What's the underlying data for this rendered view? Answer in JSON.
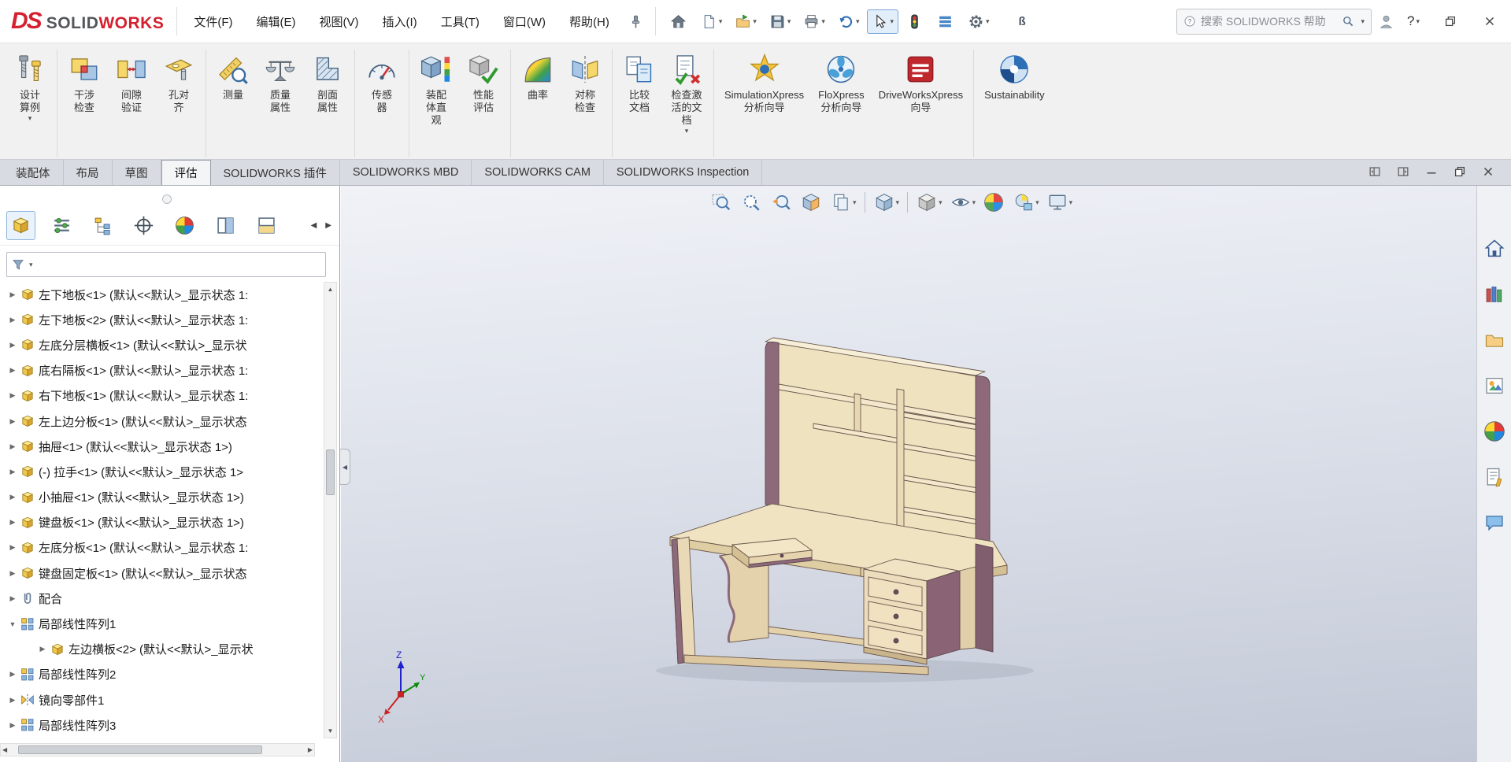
{
  "colors": {
    "brand_red": "#d5202f",
    "accent_blue": "#2f6fb6",
    "wood": "#ead9b4",
    "trim": "#8d6979",
    "viewport_top": "#f0f2f7",
    "viewport_bottom": "#c2c8d6"
  },
  "titlebar": {
    "logo": {
      "ds": "DS",
      "solid": "SOLID",
      "works": "WORKS"
    },
    "menus": [
      "文件(F)",
      "编辑(E)",
      "视图(V)",
      "插入(I)",
      "工具(T)",
      "窗口(W)",
      "帮助(H)"
    ],
    "quick_tools": [
      {
        "icon": "#q-home",
        "name": "home-button",
        "dd": ""
      },
      {
        "icon": "#q-new",
        "name": "new-document-button",
        "dd": "▾"
      },
      {
        "icon": "#q-open",
        "name": "open-document-button",
        "dd": "▾"
      },
      {
        "icon": "#q-save",
        "name": "save-button",
        "dd": "▾"
      },
      {
        "icon": "#q-print",
        "name": "print-button",
        "dd": "▾"
      },
      {
        "icon": "#q-undo",
        "name": "undo-button",
        "dd": "▾"
      },
      {
        "icon": "#q-cursor",
        "name": "select-tool-button",
        "dd": "▾",
        "cls": "active"
      },
      {
        "icon": "#q-traffic",
        "name": "rebuild-status-light",
        "dd": ""
      },
      {
        "icon": "#q-list",
        "name": "command-list-button",
        "dd": ""
      },
      {
        "icon": "#q-gear",
        "name": "options-button",
        "dd": "▾"
      },
      {
        "glyph": "ß",
        "name": "misc-tool",
        "dd": ""
      }
    ],
    "search": {
      "placeholder": "搜索 SOLIDWORKS 帮助",
      "dd": "▾"
    },
    "help": {
      "label": "?",
      "dd": "▾"
    },
    "window": [
      {
        "icon": "#w-restore",
        "name": "restore-app-button"
      },
      {
        "icon": "#w-close",
        "name": "close-app-button"
      }
    ]
  },
  "ribbon": {
    "buttons": [
      {
        "icon": "#r-study",
        "label": "设计\n算例",
        "dd": "▾",
        "name": "design-study-button",
        "cls": "grp-end"
      },
      {
        "icon": "#r-interf",
        "label": "干涉\n检查",
        "dd": "",
        "name": "interference-check-button"
      },
      {
        "icon": "#r-clear",
        "label": "间隙\n验证",
        "dd": "",
        "name": "clearance-verify-button"
      },
      {
        "icon": "#r-hole",
        "label": "孔对\n齐",
        "dd": "",
        "name": "hole-alignment-button",
        "cls": "grp-end"
      },
      {
        "icon": "#r-measure",
        "label": "测量",
        "dd": "",
        "name": "measure-button"
      },
      {
        "icon": "#r-mass",
        "label": "质量\n属性",
        "dd": "",
        "name": "mass-properties-button"
      },
      {
        "icon": "#r-secprop",
        "label": "剖面\n属性",
        "dd": "",
        "name": "section-properties-button",
        "cls": "grp-end"
      },
      {
        "icon": "#r-sensor",
        "label": "传感\n器",
        "dd": "",
        "name": "sensor-button",
        "cls": "grp-end"
      },
      {
        "icon": "#r-visual",
        "label": "装配\n体直\n观",
        "dd": "",
        "name": "assembly-visualization-button"
      },
      {
        "icon": "#r-perf",
        "label": "性能\n评估",
        "dd": "",
        "name": "performance-evaluation-button",
        "cls": "grp-end"
      },
      {
        "icon": "#r-curv",
        "label": "曲率",
        "dd": "",
        "name": "curvature-button"
      },
      {
        "icon": "#r-symm",
        "label": "对称\n检查",
        "dd": "",
        "name": "symmetry-check-button",
        "cls": "grp-end"
      },
      {
        "icon": "#r-compare",
        "label": "比较\n文档",
        "dd": "",
        "name": "compare-documents-button"
      },
      {
        "icon": "#r-checkdoc",
        "label": "检查激\n活的文\n档",
        "dd": "▾",
        "name": "check-active-document-button",
        "cls": "grp-end"
      },
      {
        "icon": "#r-simx",
        "label": "SimulationXpress\n分析向导",
        "dd": "",
        "name": "simulationxpress-button"
      },
      {
        "icon": "#r-flox",
        "label": "FloXpress\n分析向导",
        "dd": "",
        "name": "floxpress-button"
      },
      {
        "icon": "#r-dwx",
        "label": "DriveWorksXpress\n向导",
        "dd": "",
        "name": "driveworksxpress-button",
        "cls": "grp-end"
      },
      {
        "icon": "#r-sust",
        "label": "Sustainability",
        "dd": "",
        "name": "sustainability-button"
      }
    ]
  },
  "tabs": {
    "items": [
      {
        "label": "装配体",
        "cls": "",
        "name": "tab-assembly"
      },
      {
        "label": "布局",
        "cls": "",
        "name": "tab-layout"
      },
      {
        "label": "草图",
        "cls": "",
        "name": "tab-sketch"
      },
      {
        "label": "评估",
        "cls": "active",
        "name": "tab-evaluate"
      },
      {
        "label": "SOLIDWORKS 插件",
        "cls": "",
        "name": "tab-addins"
      },
      {
        "label": "SOLIDWORKS MBD",
        "cls": "",
        "name": "tab-mbd"
      },
      {
        "label": "SOLIDWORKS CAM",
        "cls": "",
        "name": "tab-cam"
      },
      {
        "label": "SOLIDWORKS Inspection",
        "cls": "",
        "name": "tab-inspection"
      }
    ],
    "doc_controls": [
      {
        "icon": "#w-pane1",
        "name": "pane-preview-left-button"
      },
      {
        "icon": "#w-pane2",
        "name": "pane-preview-right-button"
      },
      {
        "icon": "#w-min",
        "name": "minimize-document-button"
      },
      {
        "icon": "#w-restore",
        "name": "restore-document-button"
      },
      {
        "icon": "#w-close",
        "name": "close-document-button"
      }
    ]
  },
  "panel": {
    "tabs": [
      {
        "icon": "#i-part",
        "name": "featuremanager-tree-tab",
        "cls": "active"
      },
      {
        "icon": "#i-props",
        "name": "propertymanager-tab",
        "cls": ""
      },
      {
        "icon": "#i-config",
        "name": "configurationmanager-tab",
        "cls": ""
      },
      {
        "icon": "#i-target",
        "name": "dimxpertmanager-tab",
        "cls": ""
      },
      {
        "icon": "#i-ball",
        "name": "displaymanager-tab",
        "cls": ""
      },
      {
        "icon": "#i-split",
        "name": "split-pane-tab",
        "cls": ""
      },
      {
        "icon": "#i-split2",
        "name": "split-pane-2-tab",
        "cls": ""
      }
    ],
    "nav_left": "◀",
    "nav_right": "▶",
    "filter_dd": "▾",
    "collapse_glyph": "◀"
  },
  "tree": {
    "items": [
      {
        "exp": "▶",
        "icon": "#i-part",
        "label": "左下地板<1> (默认<<默认>_显示状态 1:",
        "cls": ""
      },
      {
        "exp": "▶",
        "icon": "#i-part",
        "label": "左下地板<2> (默认<<默认>_显示状态 1:",
        "cls": ""
      },
      {
        "exp": "▶",
        "icon": "#i-part",
        "label": "左底分层横板<1> (默认<<默认>_显示状",
        "cls": ""
      },
      {
        "exp": "▶",
        "icon": "#i-part",
        "label": "底右隔板<1> (默认<<默认>_显示状态 1:",
        "cls": ""
      },
      {
        "exp": "▶",
        "icon": "#i-part",
        "label": "右下地板<1> (默认<<默认>_显示状态 1:",
        "cls": ""
      },
      {
        "exp": "▶",
        "icon": "#i-part",
        "label": "左上边分板<1> (默认<<默认>_显示状态",
        "cls": ""
      },
      {
        "exp": "▶",
        "icon": "#i-part",
        "label": "抽屉<1> (默认<<默认>_显示状态 1>)",
        "cls": ""
      },
      {
        "exp": "▶",
        "icon": "#i-part",
        "label": "(-) 拉手<1> (默认<<默认>_显示状态 1>",
        "cls": ""
      },
      {
        "exp": "▶",
        "icon": "#i-part",
        "label": "小抽屉<1> (默认<<默认>_显示状态 1>)",
        "cls": ""
      },
      {
        "exp": "▶",
        "icon": "#i-part",
        "label": "键盘板<1> (默认<<默认>_显示状态 1>)",
        "cls": ""
      },
      {
        "exp": "▶",
        "icon": "#i-part",
        "label": "左底分板<1> (默认<<默认>_显示状态 1:",
        "cls": ""
      },
      {
        "exp": "▶",
        "icon": "#i-part",
        "label": "键盘固定板<1> (默认<<默认>_显示状态",
        "cls": ""
      },
      {
        "exp": "▶",
        "icon": "#i-mates",
        "label": "配合",
        "cls": ""
      },
      {
        "exp": "▼",
        "icon": "#i-pattern",
        "label": "局部线性阵列1",
        "cls": ""
      },
      {
        "exp": "▶",
        "icon": "#i-part",
        "label": "左边横板<2> (默认<<默认>_显示状",
        "cls": "child"
      },
      {
        "exp": "▶",
        "icon": "#i-pattern",
        "label": "局部线性阵列2",
        "cls": ""
      },
      {
        "exp": "▶",
        "icon": "#i-mirror",
        "label": "镜向零部件1",
        "cls": ""
      },
      {
        "exp": "▶",
        "icon": "#i-pattern",
        "label": "局部线性阵列3",
        "cls": ""
      }
    ]
  },
  "scrollbars": {
    "up": "▲",
    "down": "▼",
    "left": "◀",
    "right": "▶"
  },
  "viewport": {
    "tools": [
      {
        "icon": "#v-zoomfit",
        "name": "zoom-to-fit-button",
        "dd": "",
        "cls": ""
      },
      {
        "icon": "#v-zoomarea",
        "name": "zoom-to-area-button",
        "dd": "",
        "cls": ""
      },
      {
        "icon": "#v-prev",
        "name": "previous-view-button",
        "dd": "",
        "cls": ""
      },
      {
        "icon": "#v-section",
        "name": "section-view-button",
        "dd": "",
        "cls": ""
      },
      {
        "icon": "#v-annot",
        "name": "annotation-views-button",
        "dd": "▾",
        "cls": ""
      },
      {
        "icon": "#v-orient",
        "name": "view-orientation-button",
        "dd": "▾",
        "cls": "sep"
      },
      {
        "icon": "#v-display",
        "name": "display-style-button",
        "dd": "▾",
        "cls": "sep"
      },
      {
        "icon": "#v-hide",
        "name": "hide-show-items-button",
        "dd": "▾",
        "cls": ""
      },
      {
        "icon": "#i-ball",
        "name": "edit-appearance-button",
        "dd": "",
        "cls": ""
      },
      {
        "icon": "#v-scene",
        "name": "apply-scene-button",
        "dd": "▾",
        "cls": ""
      },
      {
        "icon": "#v-settings",
        "name": "view-settings-button",
        "dd": "▾",
        "cls": ""
      }
    ],
    "triad": {
      "x": "X",
      "y": "Y",
      "z": "Z"
    }
  },
  "taskpane": {
    "tabs": [
      {
        "icon": "#t-home",
        "name": "solidworks-resources-tab"
      },
      {
        "icon": "#t-lib",
        "name": "design-library-tab"
      },
      {
        "icon": "#t-exp",
        "name": "file-explorer-tab"
      },
      {
        "icon": "#t-pal",
        "name": "view-palette-tab"
      },
      {
        "icon": "#i-ball",
        "name": "appearances-scenes-tab"
      },
      {
        "icon": "#t-props",
        "name": "custom-properties-tab"
      },
      {
        "icon": "#t-forum",
        "name": "forum-tab"
      }
    ]
  }
}
